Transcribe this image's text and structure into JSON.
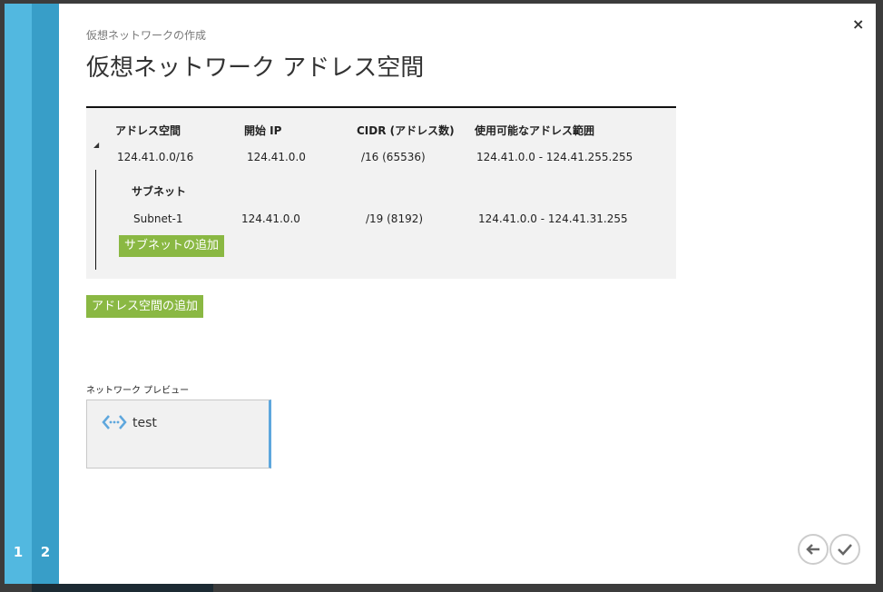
{
  "steps": [
    "1",
    "2"
  ],
  "subtitle": "仮想ネットワークの作成",
  "title": "仮想ネットワーク アドレス空間",
  "table": {
    "headers": [
      "アドレス空間",
      "開始 IP",
      "CIDR (アドレス数)",
      "使用可能なアドレス範囲"
    ],
    "address_space": {
      "space": "124.41.0.0/16",
      "start_ip": "124.41.0.0",
      "cidr": "/16 (65536)",
      "range": "124.41.0.0 - 124.41.255.255"
    },
    "subnet_header": "サブネット",
    "subnets": [
      {
        "name": "Subnet-1",
        "start_ip": "124.41.0.0",
        "cidr": "/19 (8192)",
        "range": "124.41.0.0 - 124.41.31.255"
      }
    ],
    "add_subnet": "サブネットの追加"
  },
  "add_address_space": "アドレス空間の追加",
  "preview": {
    "label": "ネットワーク プレビュー",
    "name": "test"
  },
  "close": "×"
}
